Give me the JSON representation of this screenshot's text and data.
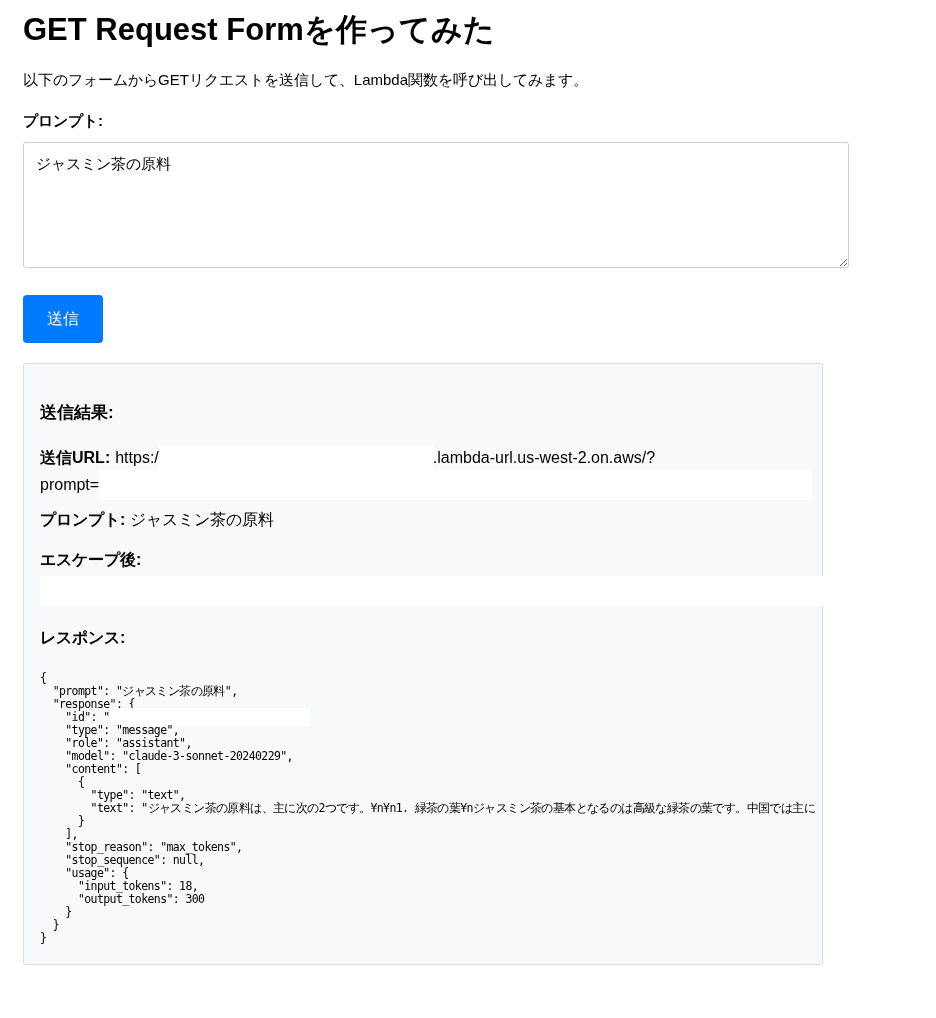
{
  "title": "GET Request Formを作ってみた",
  "intro": "以下のフォームからGETリクエストを送信して、Lambda関数を呼び出してみます。",
  "prompt_field": {
    "label": "プロンプト:",
    "value": "ジャスミン茶の原料"
  },
  "submit_button": "送信",
  "result": {
    "heading": "送信結果:",
    "url": {
      "label": "送信URL:",
      "before_redaction": "https:/",
      "after_redaction": ".lambda-url.us-west-2.on.aws/?",
      "second_line": "prompt="
    },
    "prompt": {
      "label": "プロンプト:",
      "value": "ジャスミン茶の原料"
    },
    "escaped": {
      "label": "エスケープ後:"
    },
    "response": {
      "label": "レスポンス:",
      "lines": [
        "{",
        "  \"prompt\": \"ジャスミン茶の原料\",",
        "  \"response\": {",
        "    \"id\": \"",
        "    \"type\": \"message\",",
        "    \"role\": \"assistant\",",
        "    \"model\": \"claude-3-sonnet-20240229\",",
        "    \"content\": [",
        "      {",
        "        \"type\": \"text\",",
        "        \"text\": \"ジャスミン茶の原料は、主に次の2つです。¥n¥n1. 緑茶の葉¥nジャスミン茶の基本となるのは高級な緑茶の葉です。中国では主に",
        "      }",
        "    ],",
        "    \"stop_reason\": \"max_tokens\",",
        "    \"stop_sequence\": null,",
        "    \"usage\": {",
        "      \"input_tokens\": 18,",
        "      \"output_tokens\": 300",
        "    }",
        "  }",
        "}"
      ]
    }
  }
}
